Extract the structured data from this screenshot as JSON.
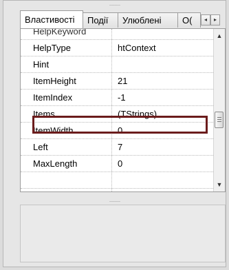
{
  "tabs": {
    "items": [
      "Властивості",
      "Події",
      "Улюблені",
      "О("
    ],
    "active": "Властивості"
  },
  "grid": {
    "partial_row": {
      "name": "HelpKeyword",
      "value": ""
    },
    "rows": [
      {
        "name": "HelpType",
        "value": "htContext"
      },
      {
        "name": "Hint",
        "value": ""
      },
      {
        "name": "ItemHeight",
        "value": "21"
      },
      {
        "name": "ItemIndex",
        "value": "-1"
      },
      {
        "name": "Items",
        "value": "(TStrings)"
      },
      {
        "name": "ItemWidth",
        "value": "0"
      },
      {
        "name": "Left",
        "value": "7"
      },
      {
        "name": "MaxLength",
        "value": "0"
      }
    ],
    "highlighted_row": "Items",
    "highlight_color": "#6b1c1c"
  },
  "icons": {
    "tab_scroll_left": "chevron-left-icon",
    "tab_scroll_right": "chevron-right-icon",
    "scroll_up": "scroll-up-icon",
    "scroll_down": "scroll-down-icon"
  },
  "glyphs": {
    "left": "◂",
    "right": "▸",
    "up": "▲",
    "down": "▼",
    "grip": "········"
  }
}
